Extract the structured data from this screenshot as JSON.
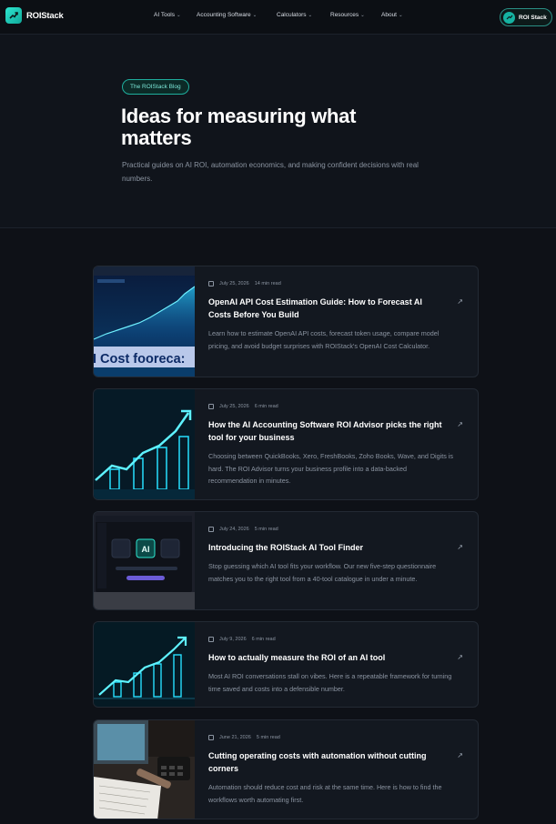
{
  "nav": {
    "brand": "ROIStack",
    "items": [
      {
        "label": "AI Tools"
      },
      {
        "label": "Accounting Software"
      },
      {
        "label": "Calculators"
      },
      {
        "label": "Resources"
      },
      {
        "label": "About"
      }
    ],
    "cta_label": "ROI Stack"
  },
  "hero": {
    "badge": "The ROIStack Blog",
    "title": "Ideas for measuring what matters",
    "subtitle": "Practical guides on AI ROI, automation economics, and making confident decisions with real numbers."
  },
  "posts": [
    {
      "date": "July 25, 2026",
      "read_time": "14 min read",
      "title": "OpenAI API Cost Estimation Guide: How to Forecast AI Costs Before You Build",
      "excerpt": "Learn how to estimate OpenAI API costs, forecast token usage, compare model pricing, and avoid budget surprises with ROIStack's OpenAI Cost Calculator.",
      "thumb_caption": "I Cost fooreca:"
    },
    {
      "date": "July 25, 2026",
      "read_time": "6 min read",
      "title": "How the AI Accounting Software ROI Advisor picks the right tool for your business",
      "excerpt": "Choosing between QuickBooks, Xero, FreshBooks, Zoho Books, Wave, and Digits is hard. The ROI Advisor turns your business profile into a data-backed recommendation in minutes."
    },
    {
      "date": "July 24, 2026",
      "read_time": "5 min read",
      "title": "Introducing the ROIStack AI Tool Finder",
      "excerpt": "Stop guessing which AI tool fits your workflow. Our new five-step questionnaire matches you to the right tool from a 40-tool catalogue in under a minute.",
      "thumb_badge": "AI"
    },
    {
      "date": "July 9, 2026",
      "read_time": "6 min read",
      "title": "How to actually measure the ROI of an AI tool",
      "excerpt": "Most AI ROI conversations stall on vibes. Here is a repeatable framework for turning time saved and costs into a defensible number."
    },
    {
      "date": "June 21, 2026",
      "read_time": "5 min read",
      "title": "Cutting operating costs with automation without cutting corners",
      "excerpt": "Automation should reduce cost and risk at the same time. Here is how to find the workflows worth automating first."
    }
  ],
  "colors": {
    "accent": "#2ee6cf",
    "background": "#0e1117",
    "card": "#131820"
  },
  "icons": {
    "logo": "trend-up-icon",
    "calendar": "calendar-icon",
    "arrow": "arrow-up-right-icon",
    "chevron": "chevron-down-icon"
  }
}
